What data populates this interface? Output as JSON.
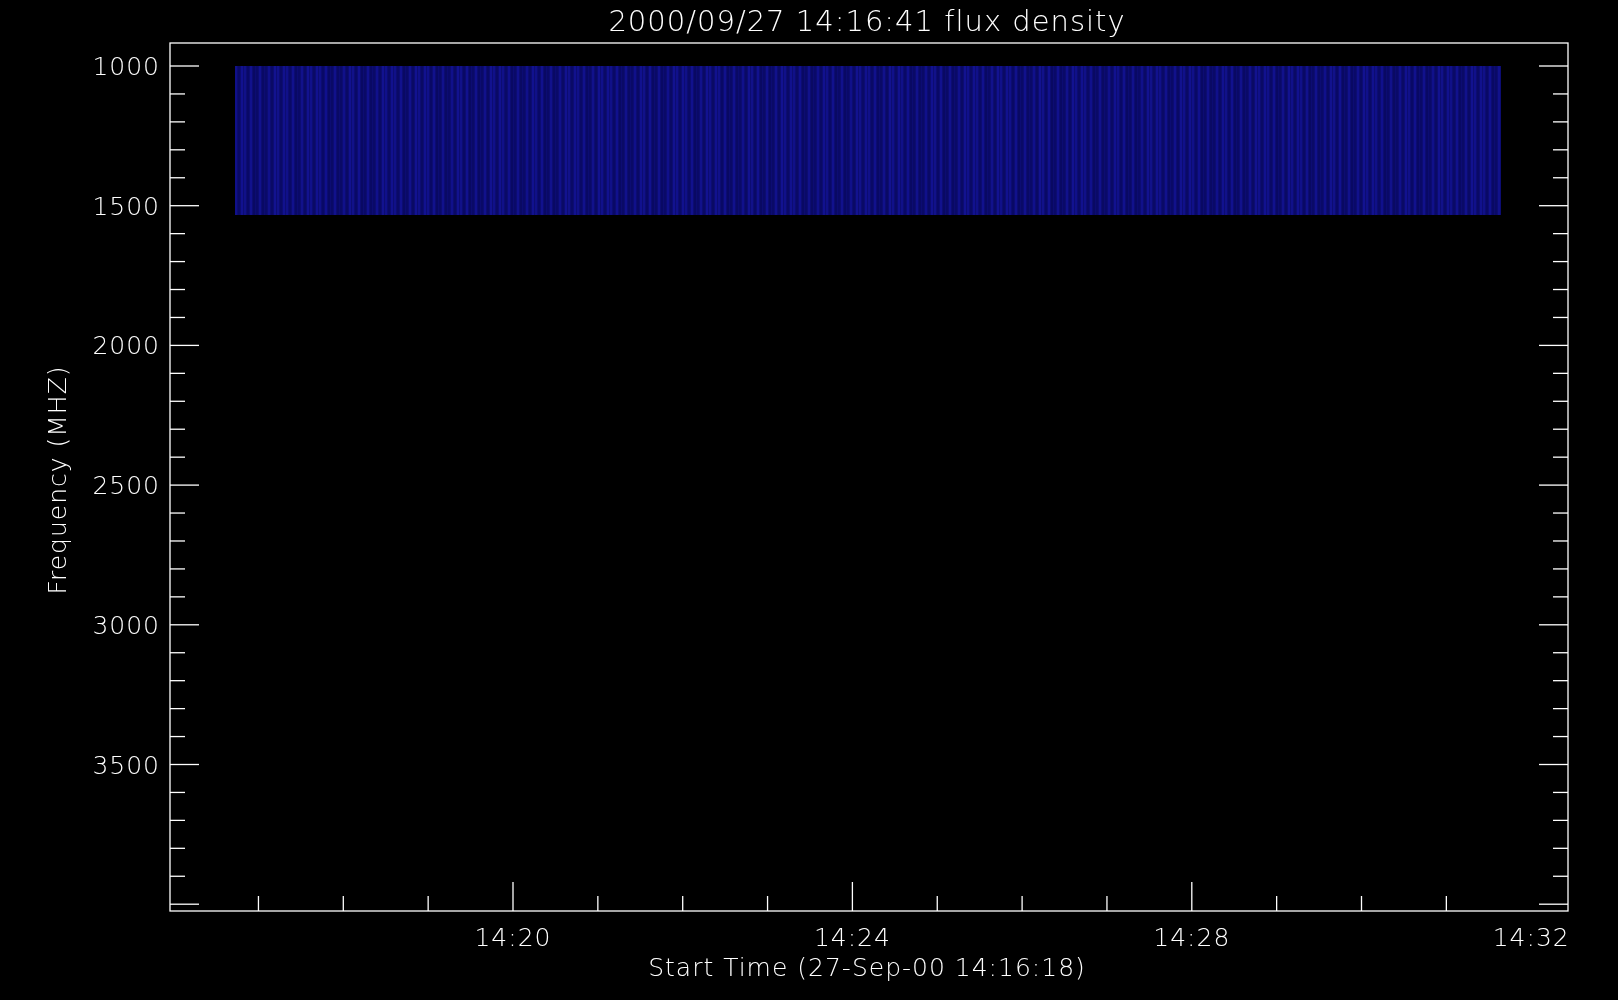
{
  "plot": {
    "title": "2000/09/27 14:16:41 flux density",
    "x_axis": {
      "title": "Start Time (27-Sep-00 14:16:18)",
      "tick_labels": [
        "14:20",
        "14:24",
        "14:28",
        "14:32"
      ]
    },
    "y_axis": {
      "title": "Frequency (MHZ)",
      "tick_labels": [
        "1000",
        "1500",
        "2000",
        "2500",
        "3000",
        "3500"
      ]
    }
  }
}
